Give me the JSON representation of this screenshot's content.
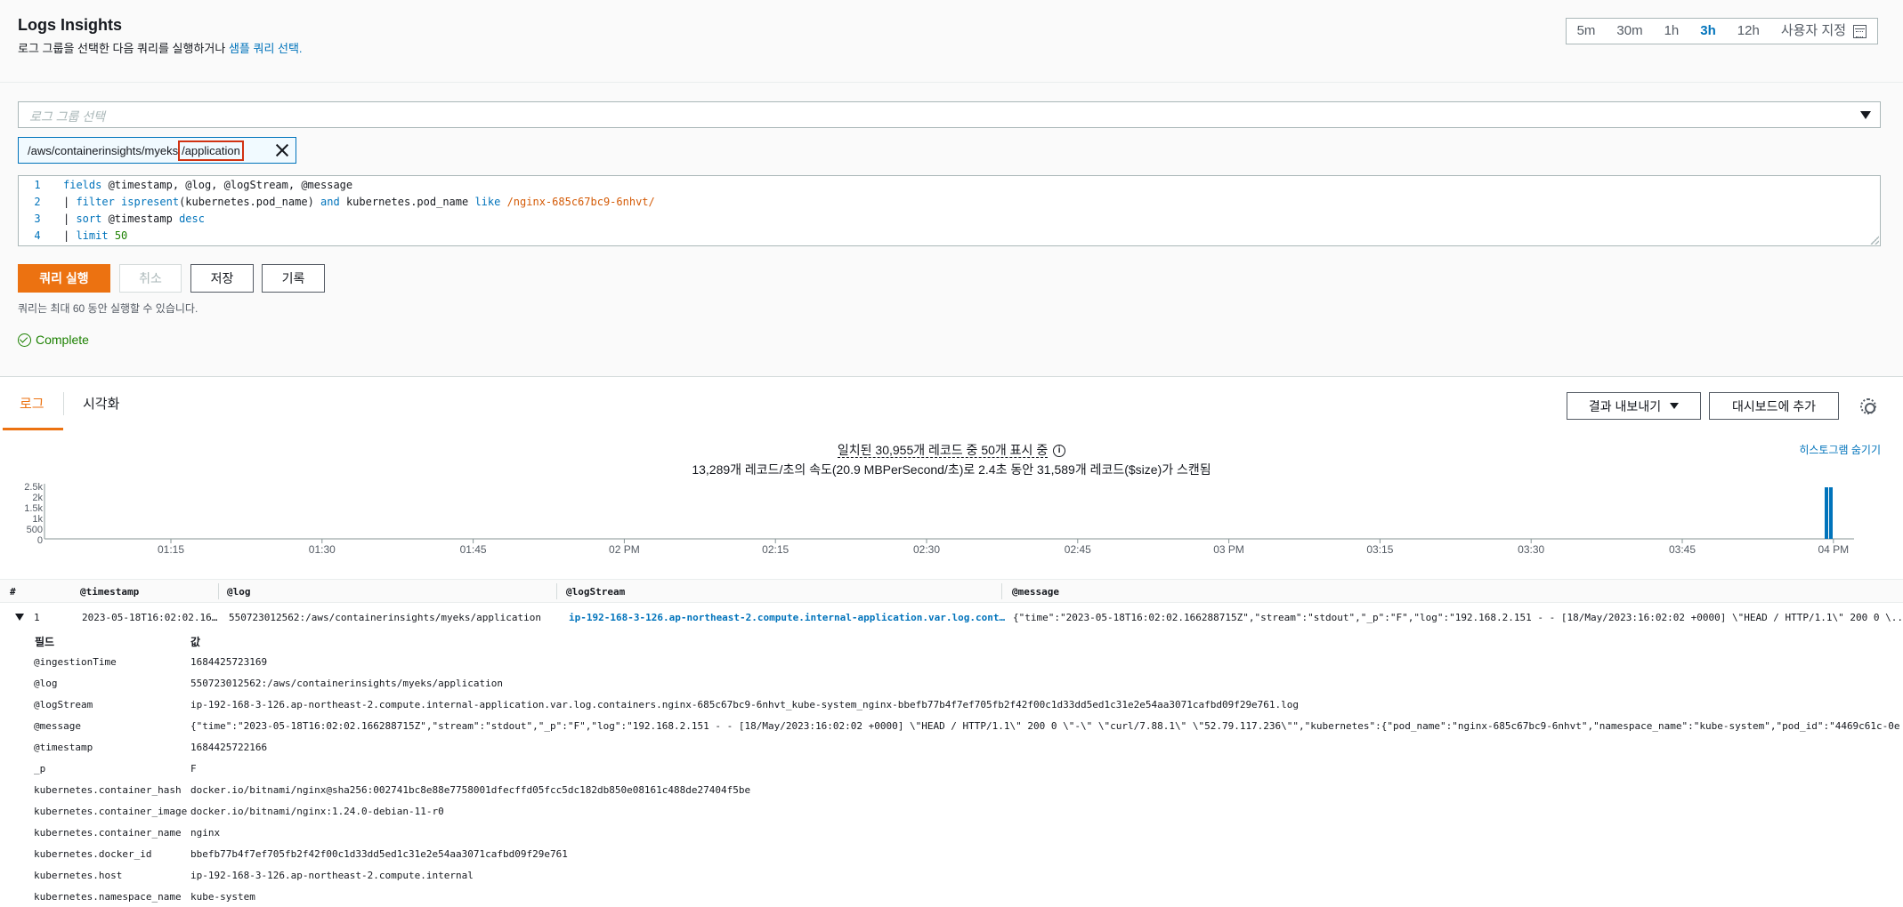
{
  "header": {
    "title": "Logs Insights",
    "subtitle_prefix": "로그 그룹을 선택한 다음 쿼리를 실행하거나 ",
    "subtitle_link": "샘플 쿼리 선택.",
    "time_options": [
      "5m",
      "30m",
      "1h",
      "3h",
      "12h"
    ],
    "active_time": "3h",
    "custom_label": "사용자 지정"
  },
  "log_group": {
    "placeholder": "로그 그룹 선택",
    "token_prefix": "/aws/containerinsights/myeks",
    "token_highlight": "/application"
  },
  "editor": {
    "lines": [
      {
        "n": "1",
        "parts": [
          [
            "kw",
            "fields"
          ],
          [
            "",
            " @timestamp, @log, @logStream, @message"
          ]
        ]
      },
      {
        "n": "2",
        "parts": [
          [
            "",
            "| "
          ],
          [
            "kw",
            "filter"
          ],
          [
            "",
            " "
          ],
          [
            "kw",
            "ispresent"
          ],
          [
            "",
            "(kubernetes.pod_name) "
          ],
          [
            "kw",
            "and"
          ],
          [
            "",
            " kubernetes.pod_name "
          ],
          [
            "kw",
            "like"
          ],
          [
            "",
            " "
          ],
          [
            "re",
            "/nginx-685c67bc9-6nhvt/"
          ]
        ]
      },
      {
        "n": "3",
        "parts": [
          [
            "",
            "| "
          ],
          [
            "kw",
            "sort"
          ],
          [
            "",
            " @timestamp "
          ],
          [
            "kw",
            "desc"
          ]
        ]
      },
      {
        "n": "4",
        "parts": [
          [
            "",
            "| "
          ],
          [
            "kw",
            "limit"
          ],
          [
            "",
            " "
          ],
          [
            "num",
            "50"
          ]
        ]
      }
    ]
  },
  "buttons": {
    "run": "쿼리 실행",
    "cancel": "취소",
    "save": "저장",
    "history": "기록"
  },
  "note": "쿼리는 최대 60 동안 실행할 수 있습니다.",
  "status": "Complete",
  "tabs": {
    "logs": "로그",
    "viz": "시각화",
    "export": "결과 내보내기",
    "dashboard": "대시보드에 추가"
  },
  "summary": {
    "line1": "일치된 30,955개 레코드 중 50개 표시 중",
    "line2": "13,289개 레코드/초의 속도(20.9 MBPerSecond/초)로 2.4초 동안 31,589개 레코드($size)가 스캔됨",
    "hide_histogram": "히스토그램 숨기기"
  },
  "histogram": {
    "y_ticks": [
      "2.5k",
      "2k",
      "1.5k",
      "1k",
      "500",
      "0"
    ],
    "x_ticks": [
      "01:15",
      "01:30",
      "01:45",
      "02 PM",
      "02:15",
      "02:30",
      "02:45",
      "03 PM",
      "03:15",
      "03:30",
      "03:45",
      "04 PM"
    ],
    "bar_color": "#0073bb"
  },
  "table": {
    "headers": [
      "#",
      "@timestamp",
      "@log",
      "@logStream",
      "@message"
    ],
    "row": {
      "num": "1",
      "timestamp": "2023-05-18T16:02:02.16…",
      "log": "550723012562:/aws/containerinsights/myeks/application",
      "logstream": "ip-192-168-3-126.ap-northeast-2.compute.internal-application.var.log.cont…",
      "message": "{\"time\":\"2023-05-18T16:02:02.166288715Z\",\"stream\":\"stdout\",\"_p\":\"F\",\"log\":\"192.168.2.151 - - [18/May/2023:16:02:02 +0000] \\\"HEAD / HTTP/1.1\\\" 200 0 \\..."
    },
    "field_header": "필드",
    "value_header": "값",
    "fields": [
      [
        "@ingestionTime",
        "1684425723169"
      ],
      [
        "@log",
        "550723012562:/aws/containerinsights/myeks/application"
      ],
      [
        "@logStream",
        "ip-192-168-3-126.ap-northeast-2.compute.internal-application.var.log.containers.nginx-685c67bc9-6nhvt_kube-system_nginx-bbefb77b4f7ef705fb2f42f00c1d33dd5ed1c31e2e54aa3071cafbd09f29e761.log"
      ],
      [
        "@message",
        "{\"time\":\"2023-05-18T16:02:02.166288715Z\",\"stream\":\"stdout\",\"_p\":\"F\",\"log\":\"192.168.2.151 - - [18/May/2023:16:02:02 +0000] \\\"HEAD / HTTP/1.1\\\" 200  0 \\\"-\\\" \\\"curl/7.88.1\\\" \\\"52.79.117.236\\\"\",\"kubernetes\":{\"pod_name\":\"nginx-685c67bc9-6nhvt\",\"namespace_name\":\"kube-system\",\"pod_id\":\"4469c61c-0e"
      ],
      [
        "@timestamp",
        "1684425722166"
      ],
      [
        "_p",
        "F"
      ],
      [
        "kubernetes.container_hash",
        "docker.io/bitnami/nginx@sha256:002741bc8e88e7758001dfecffd05fcc5dc182db850e08161c488de27404f5be"
      ],
      [
        "kubernetes.container_image",
        "docker.io/bitnami/nginx:1.24.0-debian-11-r0"
      ],
      [
        "kubernetes.container_name",
        "nginx"
      ],
      [
        "kubernetes.docker_id",
        "bbefb77b4f7ef705fb2f42f00c1d33dd5ed1c31e2e54aa3071cafbd09f29e761"
      ],
      [
        "kubernetes.host",
        "ip-192-168-3-126.ap-northeast-2.compute.internal"
      ],
      [
        "kubernetes.namespace_name",
        "kube-system"
      ]
    ]
  }
}
